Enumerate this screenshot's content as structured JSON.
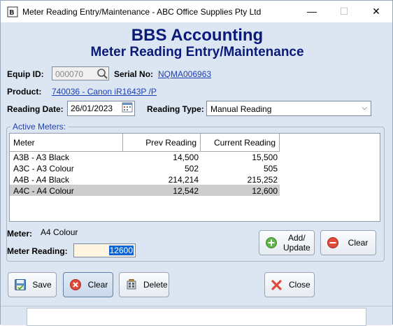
{
  "window": {
    "title": "Meter Reading Entry/Maintenance - ABC Office Supplies Pty Ltd",
    "minimize_glyph": "—",
    "maximize_glyph": "☐",
    "close_glyph": "✕"
  },
  "header": {
    "company": "BBS Accounting",
    "form_title": "Meter Reading Entry/Maintenance"
  },
  "fields": {
    "equip_id_label": "Equip ID:",
    "equip_id_value": "000070",
    "serial_no_label": "Serial No:",
    "serial_no_value": "NQMA006963",
    "product_label": "Product:",
    "product_value": "740036 - Canon iR1643P /P",
    "reading_date_label": "Reading Date:",
    "reading_date_value": "26/01/2023",
    "reading_type_label": "Reading Type:",
    "reading_type_value": "Manual Reading"
  },
  "active_meters": {
    "title": "Active Meters:",
    "columns": [
      "Meter",
      "Prev Reading",
      "Current Reading"
    ],
    "rows": [
      {
        "meter": "A3B - A3 Black",
        "prev": "14,500",
        "current": "15,500"
      },
      {
        "meter": "A3C - A3 Colour",
        "prev": "502",
        "current": "505"
      },
      {
        "meter": "A4B - A4 Black",
        "prev": "214,214",
        "current": "215,252"
      },
      {
        "meter": "A4C - A4 Colour",
        "prev": "12,542",
        "current": "12,600"
      }
    ],
    "selected_row": 3
  },
  "entry": {
    "meter_label": "Meter:",
    "meter_value": "A4 Colour",
    "meter_reading_label": "Meter Reading:",
    "meter_reading_value": "12600",
    "add_update_label_1": "Add/",
    "add_update_label_2": "Update",
    "clear_label": "Clear"
  },
  "toolbar": {
    "save_label": "Save",
    "clear_label": "Clear",
    "delete_label": "Delete",
    "close_label": "Close"
  },
  "colors": {
    "heading": "#0a1a78",
    "link": "#1e3fb4",
    "background": "#dce6f2",
    "selected_row": "#cdcdcd"
  }
}
